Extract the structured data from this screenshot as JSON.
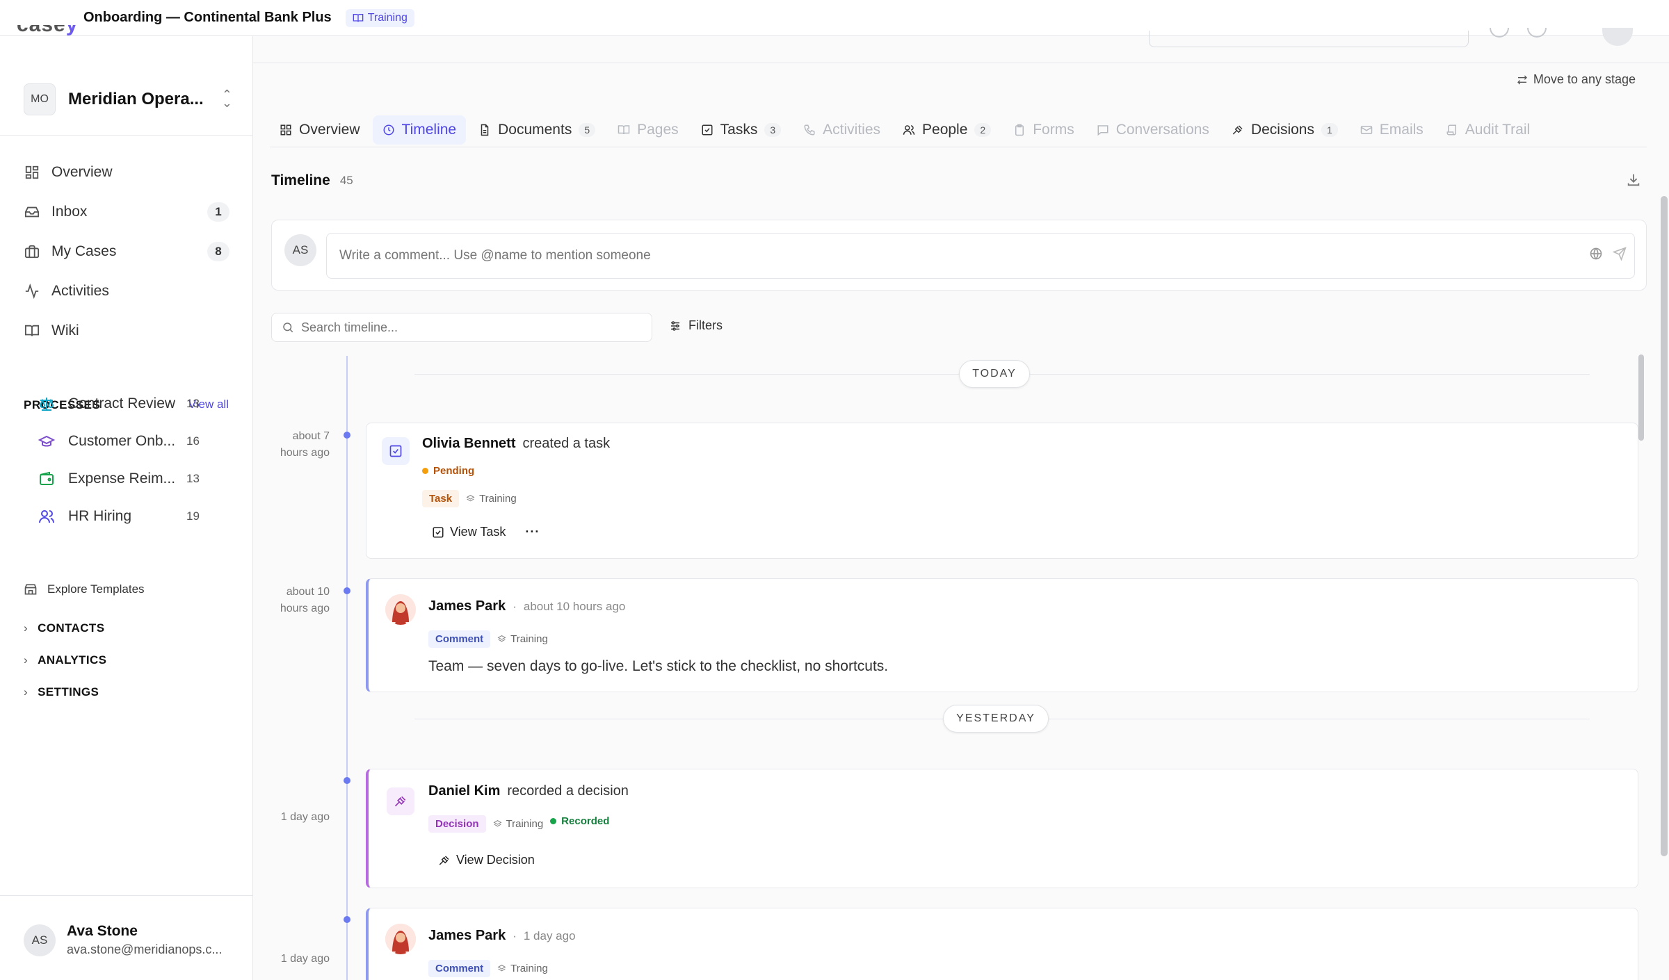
{
  "header": {
    "title": "Onboarding — Continental Bank Plus",
    "badge": "Training"
  },
  "sidebar": {
    "workspace": {
      "initials": "MO",
      "name": "Meridian Opera..."
    },
    "nav": [
      {
        "label": "Overview",
        "icon": "grid-icon"
      },
      {
        "label": "Inbox",
        "icon": "inbox-icon",
        "count": "1"
      },
      {
        "label": "My Cases",
        "icon": "briefcase-icon",
        "count": "8"
      },
      {
        "label": "Activities",
        "icon": "activity-icon"
      },
      {
        "label": "Wiki",
        "icon": "book-icon"
      }
    ],
    "processes_label": "PROCESSES",
    "view_all": "View all",
    "processes": [
      {
        "label": "Contract Review",
        "count": "13",
        "icon": "scale-icon",
        "color": "#0ea5c6"
      },
      {
        "label": "Customer Onb...",
        "count": "16",
        "icon": "graduation-cap-icon",
        "color": "#7c4dca"
      },
      {
        "label": "Expense Reim...",
        "count": "13",
        "icon": "wallet-icon",
        "color": "#16a34a"
      },
      {
        "label": "HR Hiring",
        "count": "19",
        "icon": "users-icon",
        "color": "#4f46e5"
      }
    ],
    "explore": "Explore Templates",
    "sections": [
      "CONTACTS",
      "ANALYTICS",
      "SETTINGS"
    ],
    "user": {
      "initials": "AS",
      "name": "Ava Stone",
      "email": "ava.stone@meridianops.c..."
    }
  },
  "main": {
    "move_stage": "Move to any stage",
    "tabs": [
      {
        "label": "Overview",
        "icon": "grid-icon",
        "state": "normal"
      },
      {
        "label": "Timeline",
        "icon": "clock-icon",
        "state": "active"
      },
      {
        "label": "Documents",
        "icon": "file-icon",
        "count": "5",
        "state": "normal"
      },
      {
        "label": "Pages",
        "icon": "book-icon",
        "state": "disabled"
      },
      {
        "label": "Tasks",
        "icon": "check-square-icon",
        "count": "3",
        "state": "normal"
      },
      {
        "label": "Activities",
        "icon": "phone-icon",
        "state": "disabled"
      },
      {
        "label": "People",
        "icon": "users-icon",
        "count": "2",
        "state": "normal"
      },
      {
        "label": "Forms",
        "icon": "clipboard-icon",
        "state": "disabled"
      },
      {
        "label": "Conversations",
        "icon": "message-icon",
        "state": "disabled"
      },
      {
        "label": "Decisions",
        "icon": "gavel-icon",
        "count": "1",
        "state": "normal"
      },
      {
        "label": "Emails",
        "icon": "mail-icon",
        "state": "disabled"
      },
      {
        "label": "Audit Trail",
        "icon": "scroll-icon",
        "state": "disabled"
      }
    ],
    "timeline": {
      "title": "Timeline",
      "count": "45",
      "comment_initials": "AS",
      "comment_placeholder": "Write a comment... Use @name to mention someone",
      "search_placeholder": "Search timeline...",
      "filters": "Filters",
      "day_today": "TODAY",
      "day_yesterday": "YESTERDAY",
      "events": [
        {
          "when": [
            "about 7",
            "hours ago"
          ],
          "actor": "Olivia Bennett",
          "action": "created a task",
          "status": "Pending",
          "chip": "Task",
          "tag": "Training",
          "button": "View Task"
        },
        {
          "when": [
            "about 10",
            "hours ago"
          ],
          "actor": "James Park",
          "time": "about 10 hours ago",
          "chip": "Comment",
          "tag": "Training",
          "body": "Team — seven days to go-live. Let's stick to the checklist, no shortcuts."
        },
        {
          "when": [
            "1 day ago"
          ],
          "actor": "Daniel Kim",
          "action": "recorded a decision",
          "chip": "Decision",
          "tag": "Training",
          "status": "Recorded",
          "button": "View Decision"
        },
        {
          "when": [
            "1 day ago"
          ],
          "actor": "James Park",
          "time": "1 day ago",
          "chip": "Comment",
          "tag": "Training"
        }
      ]
    }
  },
  "colors": {
    "accent": "#4f46e5",
    "pending": "#f59e0b",
    "recorded": "#16a34a"
  }
}
